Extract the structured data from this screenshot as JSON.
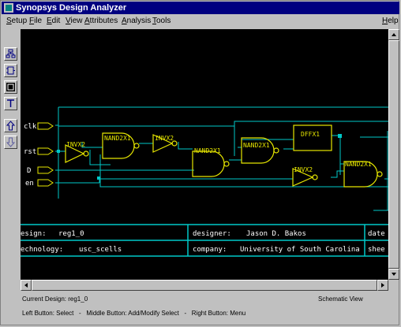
{
  "window": {
    "title": "Synopsys Design Analyzer"
  },
  "menu": {
    "items": [
      "Setup",
      "File",
      "Edit",
      "View",
      "Attributes",
      "Analysis",
      "Tools"
    ],
    "help": "Help"
  },
  "toolbar": {
    "tools": [
      "hierarchy-tool-icon",
      "symbol-tool-icon",
      "schematic-tool-icon",
      "text-tool-icon",
      "up-tool-icon",
      "down-tool-icon"
    ]
  },
  "schematic": {
    "ports": [
      "clk",
      "rst",
      "D",
      "en"
    ],
    "cells": [
      "INVX2",
      "NAND2X1",
      "INVX2",
      "NAND2X1",
      "NAND2X1",
      "DFFX1",
      "INVX2",
      "NAND2X1"
    ],
    "title_block": {
      "design_label": "esign:",
      "design_value": "reg1_0",
      "designer_label": "designer:",
      "designer_value": "Jason D. Bakos",
      "date_label": "date",
      "technology_label": "echnology:",
      "technology_value": "usc_scells",
      "company_label": "company:",
      "company_value": "University of South Carolina",
      "sheet_label": "shee"
    },
    "colors": {
      "wire": "#00c8c8",
      "gate": "#e6e600",
      "label": "#ffffff",
      "background": "#000000"
    }
  },
  "status": {
    "current_design": "Current Design: reg1_0",
    "view": "Schematic View",
    "buttons": "Left Button: Select   -   Middle Button: Add/Modify Select   -   Right Button: Menu"
  }
}
